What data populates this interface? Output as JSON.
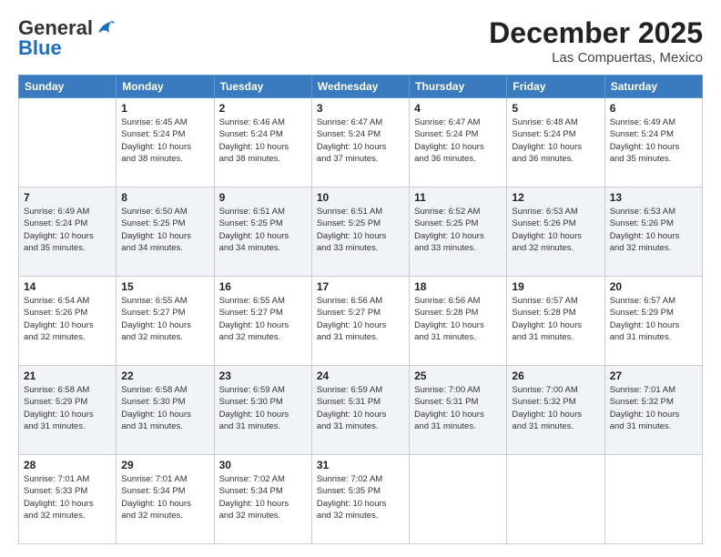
{
  "logo": {
    "general": "General",
    "blue": "Blue"
  },
  "header": {
    "title": "December 2025",
    "subtitle": "Las Compuertas, Mexico"
  },
  "days_of_week": [
    "Sunday",
    "Monday",
    "Tuesday",
    "Wednesday",
    "Thursday",
    "Friday",
    "Saturday"
  ],
  "weeks": [
    [
      {
        "day": "",
        "info": ""
      },
      {
        "day": "1",
        "info": "Sunrise: 6:45 AM\nSunset: 5:24 PM\nDaylight: 10 hours\nand 38 minutes."
      },
      {
        "day": "2",
        "info": "Sunrise: 6:46 AM\nSunset: 5:24 PM\nDaylight: 10 hours\nand 38 minutes."
      },
      {
        "day": "3",
        "info": "Sunrise: 6:47 AM\nSunset: 5:24 PM\nDaylight: 10 hours\nand 37 minutes."
      },
      {
        "day": "4",
        "info": "Sunrise: 6:47 AM\nSunset: 5:24 PM\nDaylight: 10 hours\nand 36 minutes."
      },
      {
        "day": "5",
        "info": "Sunrise: 6:48 AM\nSunset: 5:24 PM\nDaylight: 10 hours\nand 36 minutes."
      },
      {
        "day": "6",
        "info": "Sunrise: 6:49 AM\nSunset: 5:24 PM\nDaylight: 10 hours\nand 35 minutes."
      }
    ],
    [
      {
        "day": "7",
        "info": "Sunrise: 6:49 AM\nSunset: 5:24 PM\nDaylight: 10 hours\nand 35 minutes."
      },
      {
        "day": "8",
        "info": "Sunrise: 6:50 AM\nSunset: 5:25 PM\nDaylight: 10 hours\nand 34 minutes."
      },
      {
        "day": "9",
        "info": "Sunrise: 6:51 AM\nSunset: 5:25 PM\nDaylight: 10 hours\nand 34 minutes."
      },
      {
        "day": "10",
        "info": "Sunrise: 6:51 AM\nSunset: 5:25 PM\nDaylight: 10 hours\nand 33 minutes."
      },
      {
        "day": "11",
        "info": "Sunrise: 6:52 AM\nSunset: 5:25 PM\nDaylight: 10 hours\nand 33 minutes."
      },
      {
        "day": "12",
        "info": "Sunrise: 6:53 AM\nSunset: 5:26 PM\nDaylight: 10 hours\nand 32 minutes."
      },
      {
        "day": "13",
        "info": "Sunrise: 6:53 AM\nSunset: 5:26 PM\nDaylight: 10 hours\nand 32 minutes."
      }
    ],
    [
      {
        "day": "14",
        "info": "Sunrise: 6:54 AM\nSunset: 5:26 PM\nDaylight: 10 hours\nand 32 minutes."
      },
      {
        "day": "15",
        "info": "Sunrise: 6:55 AM\nSunset: 5:27 PM\nDaylight: 10 hours\nand 32 minutes."
      },
      {
        "day": "16",
        "info": "Sunrise: 6:55 AM\nSunset: 5:27 PM\nDaylight: 10 hours\nand 32 minutes."
      },
      {
        "day": "17",
        "info": "Sunrise: 6:56 AM\nSunset: 5:27 PM\nDaylight: 10 hours\nand 31 minutes."
      },
      {
        "day": "18",
        "info": "Sunrise: 6:56 AM\nSunset: 5:28 PM\nDaylight: 10 hours\nand 31 minutes."
      },
      {
        "day": "19",
        "info": "Sunrise: 6:57 AM\nSunset: 5:28 PM\nDaylight: 10 hours\nand 31 minutes."
      },
      {
        "day": "20",
        "info": "Sunrise: 6:57 AM\nSunset: 5:29 PM\nDaylight: 10 hours\nand 31 minutes."
      }
    ],
    [
      {
        "day": "21",
        "info": "Sunrise: 6:58 AM\nSunset: 5:29 PM\nDaylight: 10 hours\nand 31 minutes."
      },
      {
        "day": "22",
        "info": "Sunrise: 6:58 AM\nSunset: 5:30 PM\nDaylight: 10 hours\nand 31 minutes."
      },
      {
        "day": "23",
        "info": "Sunrise: 6:59 AM\nSunset: 5:30 PM\nDaylight: 10 hours\nand 31 minutes."
      },
      {
        "day": "24",
        "info": "Sunrise: 6:59 AM\nSunset: 5:31 PM\nDaylight: 10 hours\nand 31 minutes."
      },
      {
        "day": "25",
        "info": "Sunrise: 7:00 AM\nSunset: 5:31 PM\nDaylight: 10 hours\nand 31 minutes."
      },
      {
        "day": "26",
        "info": "Sunrise: 7:00 AM\nSunset: 5:32 PM\nDaylight: 10 hours\nand 31 minutes."
      },
      {
        "day": "27",
        "info": "Sunrise: 7:01 AM\nSunset: 5:32 PM\nDaylight: 10 hours\nand 31 minutes."
      }
    ],
    [
      {
        "day": "28",
        "info": "Sunrise: 7:01 AM\nSunset: 5:33 PM\nDaylight: 10 hours\nand 32 minutes."
      },
      {
        "day": "29",
        "info": "Sunrise: 7:01 AM\nSunset: 5:34 PM\nDaylight: 10 hours\nand 32 minutes."
      },
      {
        "day": "30",
        "info": "Sunrise: 7:02 AM\nSunset: 5:34 PM\nDaylight: 10 hours\nand 32 minutes."
      },
      {
        "day": "31",
        "info": "Sunrise: 7:02 AM\nSunset: 5:35 PM\nDaylight: 10 hours\nand 32 minutes."
      },
      {
        "day": "",
        "info": ""
      },
      {
        "day": "",
        "info": ""
      },
      {
        "day": "",
        "info": ""
      }
    ]
  ]
}
